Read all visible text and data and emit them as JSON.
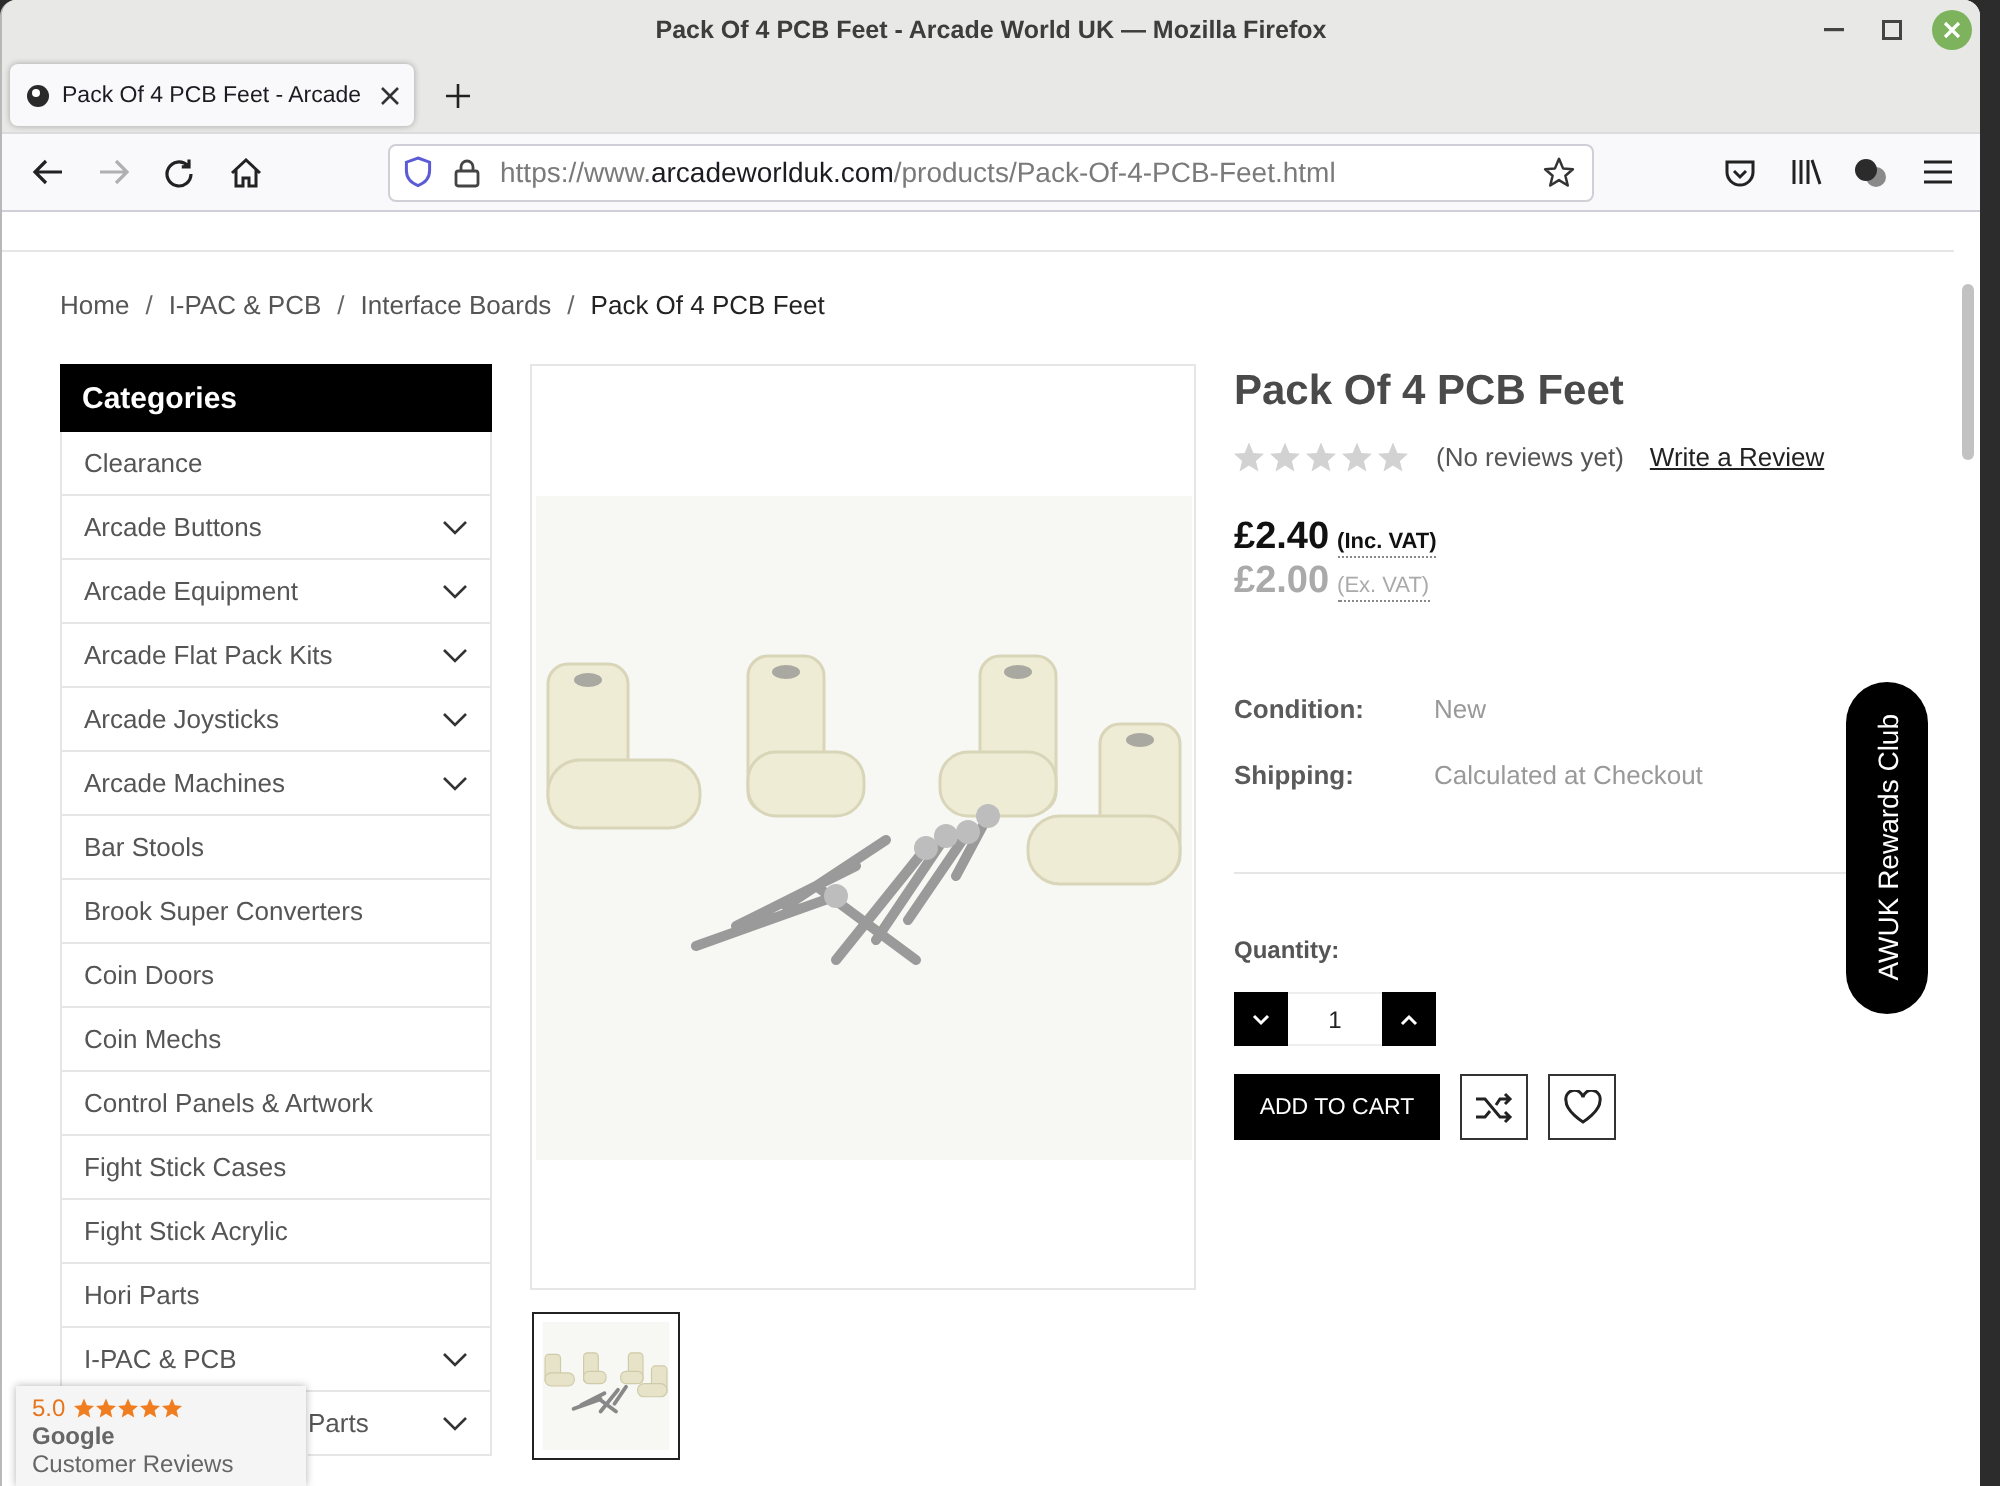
{
  "window": {
    "title": "Pack Of 4 PCB Feet - Arcade World UK — Mozilla Firefox"
  },
  "tabs": [
    {
      "title": "Pack Of 4 PCB Feet - Arcade",
      "selected": true
    }
  ],
  "toolbar": {
    "nav_buttons": [
      {
        "kind": "back",
        "disabled": false
      },
      {
        "kind": "forward",
        "disabled": true
      },
      {
        "kind": "reload",
        "disabled": false
      },
      {
        "kind": "home",
        "disabled": false
      }
    ],
    "url": {
      "prefix": "https://www.",
      "domain": "arcadeworlduk.com",
      "path": "/products/Pack-Of-4-PCB-Feet.html"
    }
  },
  "breadcrumb": {
    "separator": "/",
    "items": [
      {
        "label": "Home",
        "current": false
      },
      {
        "label": "I-PAC & PCB",
        "current": false
      },
      {
        "label": "Interface Boards",
        "current": false
      },
      {
        "label": "Pack Of 4 PCB Feet",
        "current": true
      }
    ]
  },
  "sidebar": {
    "title": "Categories",
    "items": [
      {
        "label": "Clearance",
        "has_submenu": false,
        "partly_hidden": false
      },
      {
        "label": "Arcade Buttons",
        "has_submenu": true,
        "partly_hidden": false
      },
      {
        "label": "Arcade Equipment",
        "has_submenu": true,
        "partly_hidden": false
      },
      {
        "label": "Arcade Flat Pack Kits",
        "has_submenu": true,
        "partly_hidden": false
      },
      {
        "label": "Arcade Joysticks",
        "has_submenu": true,
        "partly_hidden": false
      },
      {
        "label": "Arcade Machines",
        "has_submenu": true,
        "partly_hidden": false
      },
      {
        "label": "Bar Stools",
        "has_submenu": false,
        "partly_hidden": false
      },
      {
        "label": "Brook Super Converters",
        "has_submenu": false,
        "partly_hidden": false
      },
      {
        "label": "Coin Doors",
        "has_submenu": false,
        "partly_hidden": false
      },
      {
        "label": "Coin Mechs",
        "has_submenu": false,
        "partly_hidden": false
      },
      {
        "label": "Control Panels & Artwork",
        "has_submenu": false,
        "partly_hidden": false
      },
      {
        "label": "Fight Stick Cases",
        "has_submenu": false,
        "partly_hidden": false
      },
      {
        "label": "Fight Stick Acrylic",
        "has_submenu": false,
        "partly_hidden": false
      },
      {
        "label": "Hori Parts",
        "has_submenu": false,
        "partly_hidden": false
      },
      {
        "label": "I-PAC & PCB",
        "has_submenu": true,
        "partly_hidden": false
      },
      {
        "label": "Parts",
        "has_submenu": true,
        "partly_hidden": true
      }
    ]
  },
  "gallery": {
    "thumbnails": [
      {
        "selected": true
      }
    ]
  },
  "product": {
    "title": "Pack Of 4 PCB Feet",
    "stars": 0,
    "review_count": "(No reviews yet)",
    "review_link": "Write a Review",
    "prices": [
      {
        "amount": "£2.40",
        "tax_label": "(Inc. VAT)",
        "kind": "main"
      },
      {
        "amount": "£2.00",
        "tax_label": "(Ex. VAT)",
        "kind": "secondary"
      }
    ],
    "details": [
      {
        "label": "Condition:",
        "value": "New"
      },
      {
        "label": "Shipping:",
        "value": "Calculated at Checkout"
      }
    ],
    "quantity_label": "Quantity:",
    "quantity": "1",
    "add_to_cart": "ADD TO CART"
  },
  "rewards_tab": {
    "label": "AWUK Rewards Club"
  },
  "review_badge": {
    "score": "5.0",
    "stars": 5,
    "brand": "Google",
    "caption": "Customer Reviews"
  }
}
